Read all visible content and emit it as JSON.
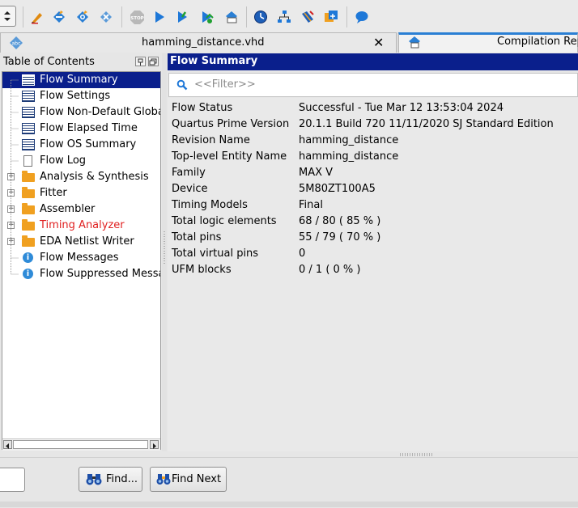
{
  "toolbar": {
    "icons": [
      "spinner",
      "edit-icon",
      "analysis-icon",
      "analysis-synthesis-icon",
      "fitter-icon",
      "stop-icon",
      "start-compilation-icon",
      "timing-icon",
      "netlist-icon",
      "report-icon",
      "chip-planner-icon",
      "hierarchy-icon",
      "pin-planner-icon",
      "programmer-icon",
      "chat-icon"
    ],
    "stop_label": "STOP"
  },
  "tabs": [
    {
      "label": "hamming_distance.vhd",
      "close": "✕"
    },
    {
      "label": "Compilation Rep"
    }
  ],
  "toc": {
    "title": "Table of Contents",
    "items": [
      {
        "label": "Flow Summary",
        "icon": "table",
        "selected": true
      },
      {
        "label": "Flow Settings",
        "icon": "table"
      },
      {
        "label": "Flow Non-Default Global",
        "icon": "table"
      },
      {
        "label": "Flow Elapsed Time",
        "icon": "table"
      },
      {
        "label": "Flow OS Summary",
        "icon": "table"
      },
      {
        "label": "Flow Log",
        "icon": "document"
      },
      {
        "label": "Analysis & Synthesis",
        "icon": "folder",
        "expandable": true
      },
      {
        "label": "Fitter",
        "icon": "folder",
        "expandable": true
      },
      {
        "label": "Assembler",
        "icon": "folder",
        "expandable": true
      },
      {
        "label": "Timing Analyzer",
        "icon": "folder",
        "expandable": true,
        "color": "#e02020"
      },
      {
        "label": "EDA Netlist Writer",
        "icon": "folder",
        "expandable": true
      },
      {
        "label": "Flow Messages",
        "icon": "info"
      },
      {
        "label": "Flow Suppressed Messag",
        "icon": "info"
      }
    ]
  },
  "summary": {
    "title": "Flow Summary",
    "filter_placeholder": "<<Filter>>",
    "rows": [
      {
        "key": "Flow Status",
        "value": "Successful - Tue Mar 12 13:53:04 2024"
      },
      {
        "key": "Quartus Prime Version",
        "value": "20.1.1 Build 720 11/11/2020 SJ Standard Edition"
      },
      {
        "key": "Revision Name",
        "value": "hamming_distance"
      },
      {
        "key": "Top-level Entity Name",
        "value": "hamming_distance"
      },
      {
        "key": "Family",
        "value": "MAX V"
      },
      {
        "key": "Device",
        "value": "5M80ZT100A5"
      },
      {
        "key": "Timing Models",
        "value": "Final"
      },
      {
        "key": "Total logic elements",
        "value": "68 / 80 ( 85 % )"
      },
      {
        "key": "Total pins",
        "value": "55 / 79 ( 70 % )"
      },
      {
        "key": "Total virtual pins",
        "value": "0"
      },
      {
        "key": "UFM blocks",
        "value": "0 / 1 ( 0 % )"
      }
    ]
  },
  "bottom": {
    "find_label": "Find...",
    "find_next_label": "Find Next"
  },
  "colors": {
    "selection": "#0a1f8c",
    "warning_text": "#e02020"
  }
}
